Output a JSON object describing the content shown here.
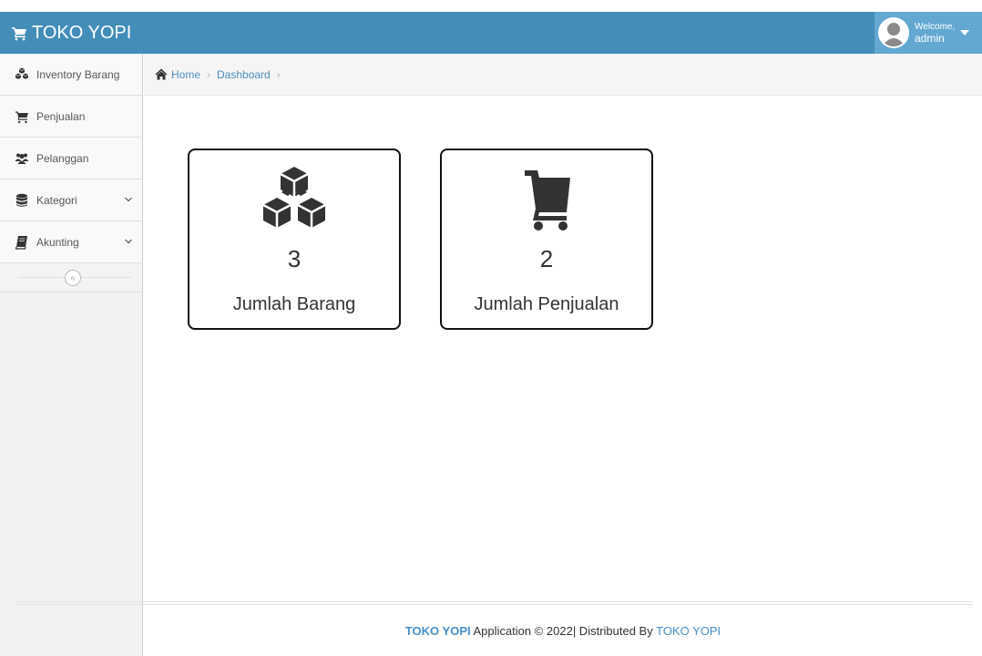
{
  "navbar": {
    "brand": "TOKO YOPI",
    "welcome": "Welcome,",
    "username": "admin"
  },
  "sidebar": {
    "items": [
      {
        "label": "Inventory Barang",
        "icon": "cubes-icon"
      },
      {
        "label": "Penjualan",
        "icon": "cart-icon"
      },
      {
        "label": "Pelanggan",
        "icon": "users-icon"
      },
      {
        "label": "Kategori",
        "icon": "database-icon"
      },
      {
        "label": "Akunting",
        "icon": "book-icon"
      }
    ]
  },
  "breadcrumb": {
    "home": "Home",
    "current": "Dashboard"
  },
  "cards": [
    {
      "value": "3",
      "label": "Jumlah Barang",
      "icon": "cubes-icon"
    },
    {
      "value": "2",
      "label": "Jumlah Penjualan",
      "icon": "cart-icon"
    }
  ],
  "footer": {
    "brand": "TOKO YOPI",
    "middle": " Application © 2022| Distributed By ",
    "brand2": "TOKO YOPI"
  },
  "colors": {
    "navbar": "#438eb9",
    "user_box": "#62a8d1",
    "link": "#4c8fbd"
  }
}
